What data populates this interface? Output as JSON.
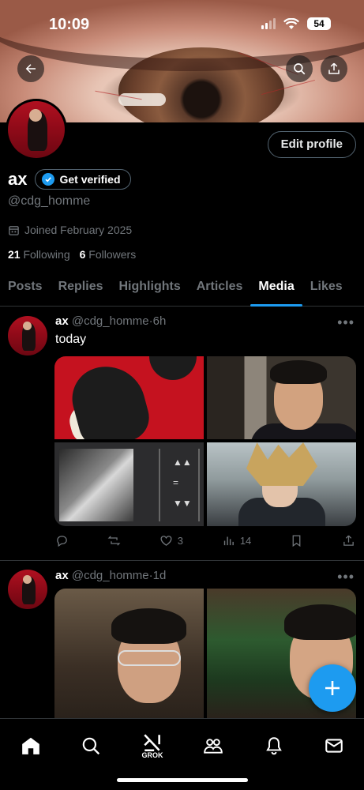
{
  "status_bar": {
    "time": "10:09",
    "battery": "54"
  },
  "profile": {
    "display_name": "ax",
    "get_verified_label": "Get verified",
    "handle": "@cdg_homme",
    "joined": "Joined February 2025",
    "following_count": "21",
    "following_label": "Following",
    "followers_count": "6",
    "followers_label": "Followers",
    "edit_profile_label": "Edit profile"
  },
  "tabs": [
    {
      "label": "Posts",
      "active": false
    },
    {
      "label": "Replies",
      "active": false
    },
    {
      "label": "Highlights",
      "active": false
    },
    {
      "label": "Articles",
      "active": false
    },
    {
      "label": "Media",
      "active": true
    },
    {
      "label": "Likes",
      "active": false
    }
  ],
  "posts": [
    {
      "name": "ax",
      "handle": "@cdg_homme",
      "time": "6h",
      "text": "today",
      "likes": "3",
      "views": "14"
    },
    {
      "name": "ax",
      "handle": "@cdg_homme",
      "time": "1d"
    }
  ],
  "nav": {
    "grok_label": "GROK"
  },
  "colors": {
    "accent": "#1d9bf0",
    "background": "#000000",
    "secondary_text": "#71767b",
    "divider": "#2f3336"
  }
}
